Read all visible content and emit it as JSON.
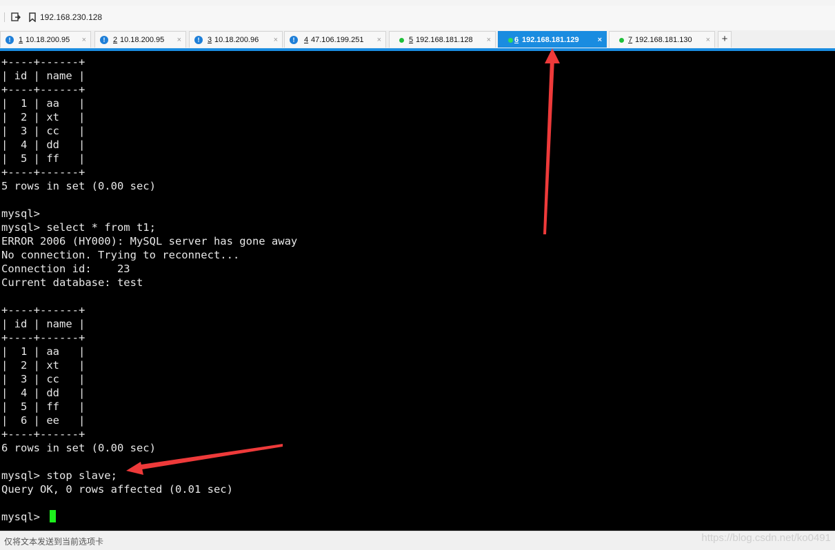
{
  "address_bar": {
    "address": "192.168.230.128"
  },
  "tabs": [
    {
      "status": "alert",
      "number": "1",
      "host": "10.18.200.95"
    },
    {
      "status": "alert",
      "number": "2",
      "host": "10.18.200.95"
    },
    {
      "status": "alert",
      "number": "3",
      "host": "10.18.200.96"
    },
    {
      "status": "alert",
      "number": "4",
      "host": "47.106.199.251"
    },
    {
      "status": "connected",
      "number": "5",
      "host": "192.168.181.128"
    },
    {
      "status": "connected",
      "number": "6",
      "host": "192.168.181.129",
      "active": true
    },
    {
      "status": "connected",
      "number": "7",
      "host": "192.168.181.130"
    }
  ],
  "tab_close_glyph": "×",
  "tab_add_glyph": "+",
  "alert_glyph": "!",
  "terminal": {
    "lines": [
      "+----+------+",
      "| id | name |",
      "+----+------+",
      "|  1 | aa   |",
      "|  2 | xt   |",
      "|  3 | cc   |",
      "|  4 | dd   |",
      "|  5 | ff   |",
      "+----+------+",
      "5 rows in set (0.00 sec)",
      "",
      "mysql>",
      "mysql> select * from t1;",
      "ERROR 2006 (HY000): MySQL server has gone away",
      "No connection. Trying to reconnect...",
      "Connection id:    23",
      "Current database: test",
      "",
      "+----+------+",
      "| id | name |",
      "+----+------+",
      "|  1 | aa   |",
      "|  2 | xt   |",
      "|  3 | cc   |",
      "|  4 | dd   |",
      "|  5 | ff   |",
      "|  6 | ee   |",
      "+----+------+",
      "6 rows in set (0.00 sec)",
      "",
      "mysql> stop slave;",
      "Query OK, 0 rows affected (0.01 sec)",
      "",
      "mysql> "
    ],
    "text_color": "#e8e8e8",
    "cursor_color": "#1df01d"
  },
  "status_bar": {
    "text": "仅将文本发送到当前选项卡",
    "watermark": "https://blog.csdn.net/ko0491"
  },
  "colors": {
    "accent": "#1a8ce0",
    "annotation_arrow": "#ee3a3a",
    "connected": "#1fbf3a"
  }
}
